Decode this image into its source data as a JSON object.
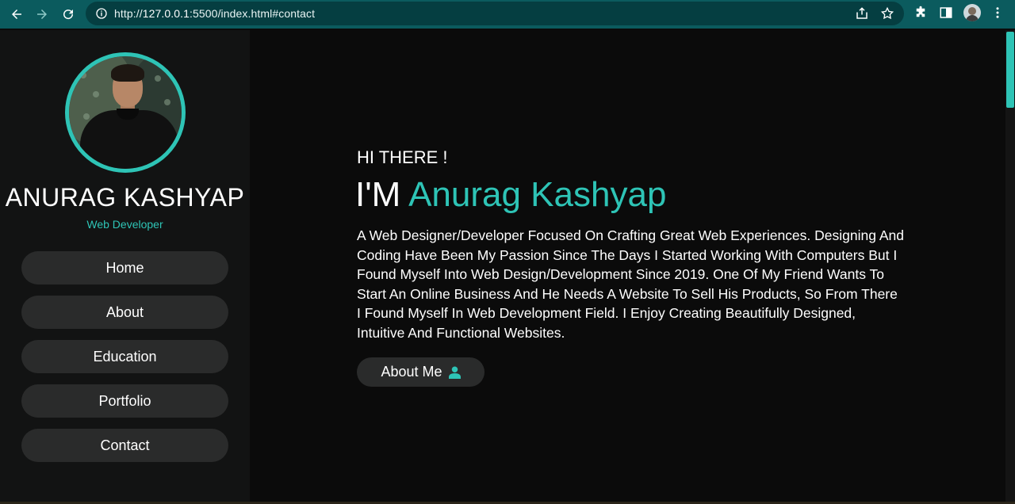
{
  "browser": {
    "url_prefix": "http://",
    "url_host": "127.0.0.1",
    "url_rest": ":5500/index.html#contact"
  },
  "profile": {
    "name": "ANURAG KASHYAP",
    "role": "Web Developer"
  },
  "nav": {
    "items": [
      {
        "label": "Home"
      },
      {
        "label": "About"
      },
      {
        "label": "Education"
      },
      {
        "label": "Portfolio"
      },
      {
        "label": "Contact"
      }
    ]
  },
  "hero": {
    "greeting": "HI THERE !",
    "im": "I'M ",
    "name": "Anurag Kashyap",
    "bio": "A Web Designer/Developer Focused On Crafting Great Web Experiences. Designing And Coding Have Been My Passion Since The Days I Started Working With Computers But I Found Myself Into Web Design/Development Since 2019. One Of My Friend Wants To Start An Online Business And He Needs A Website To Sell His Products, So From There I Found Myself In Web Development Field. I Enjoy Creating Beautifully Designed, Intuitive And Functional Websites.",
    "button_label": "About Me"
  },
  "colors": {
    "accent": "#2ec4b6",
    "chrome": "#0b5b5e",
    "sidebar": "#121313",
    "button": "#2a2b2b"
  },
  "icons": {
    "back": "arrow-left-icon",
    "forward": "arrow-right-icon",
    "reload": "reload-icon",
    "info": "info-icon",
    "share": "share-icon",
    "bookmark": "star-icon",
    "extensions": "puzzle-icon",
    "sidepanel": "sidepanel-icon",
    "menu": "kebab-menu-icon",
    "about_button": "user-icon"
  }
}
